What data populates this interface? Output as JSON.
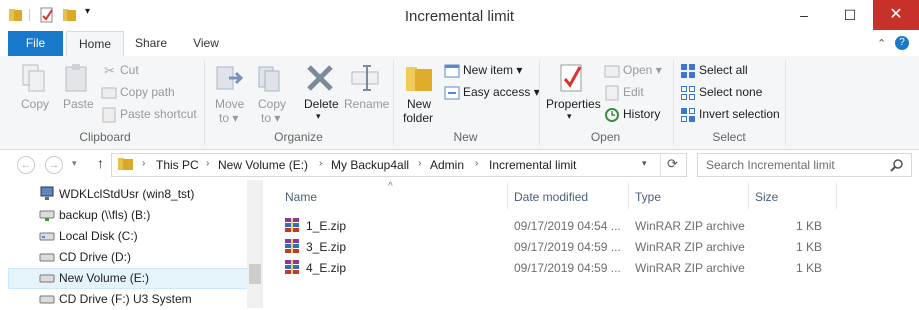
{
  "window": {
    "title": "Incremental limit",
    "minimize": "–",
    "maximize": "☐",
    "close": "✕"
  },
  "tabs": {
    "file": "File",
    "home": "Home",
    "share": "Share",
    "view": "View",
    "help_icon": "?"
  },
  "ribbon": {
    "clipboard": {
      "copy": "Copy",
      "paste": "Paste",
      "cut": "Cut",
      "copy_path": "Copy path",
      "paste_shortcut": "Paste shortcut",
      "group": "Clipboard"
    },
    "organize": {
      "move_to": "Move",
      "move_to2": "to ▾",
      "copy_to": "Copy",
      "copy_to2": "to ▾",
      "delete": "Delete",
      "delete_arrow": "▾",
      "rename": "Rename",
      "group": "Organize"
    },
    "new": {
      "new_folder": "New",
      "new_folder2": "folder",
      "new_item": "New item ▾",
      "easy_access": "Easy access ▾",
      "group": "New"
    },
    "open": {
      "properties": "Properties",
      "properties_arrow": "▾",
      "open": "Open ▾",
      "edit": "Edit",
      "history": "History",
      "group": "Open"
    },
    "select": {
      "select_all": "Select all",
      "select_none": "Select none",
      "invert_selection": "Invert selection",
      "group": "Select"
    }
  },
  "address": {
    "back": "←",
    "forward": "→",
    "recent": "▾",
    "up": "↑",
    "crumbs": [
      "This PC",
      "New Volume (E:)",
      "My Backup4all",
      "Admin",
      "Incremental limit"
    ],
    "dropdown": "▾",
    "refresh": "⟳",
    "search_placeholder": "Search Incremental limit"
  },
  "nav": [
    {
      "label": "WDKLclStdUsr (win8_tst)",
      "icon": "network-computer-icon"
    },
    {
      "label": "backup (\\\\fls) (B:)",
      "icon": "network-drive-icon"
    },
    {
      "label": "Local Disk (C:)",
      "icon": "local-disk-icon"
    },
    {
      "label": "CD Drive (D:)",
      "icon": "cd-drive-icon"
    },
    {
      "label": "New Volume (E:)",
      "icon": "drive-icon",
      "selected": true
    },
    {
      "label": "CD Drive (F:) U3 System",
      "icon": "cd-drive-icon"
    }
  ],
  "columns": {
    "name": "Name",
    "date": "Date modified",
    "type": "Type",
    "size": "Size",
    "sort_arrow": "^"
  },
  "files": [
    {
      "name": "1_E.zip",
      "date": "09/17/2019 04:54 ...",
      "type": "WinRAR ZIP archive",
      "size": "1 KB"
    },
    {
      "name": "3_E.zip",
      "date": "09/17/2019 04:59 ...",
      "type": "WinRAR ZIP archive",
      "size": "1 KB"
    },
    {
      "name": "4_E.zip",
      "date": "09/17/2019 04:59 ...",
      "type": "WinRAR ZIP archive",
      "size": "1 KB"
    }
  ],
  "colors": {
    "accent": "#1979ca",
    "close": "#c7312a",
    "selected": "#cce8ff",
    "folder": "#e8c04a"
  }
}
